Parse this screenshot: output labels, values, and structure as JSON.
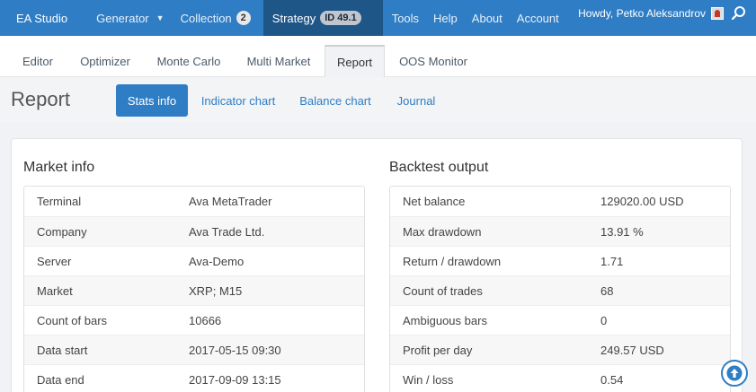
{
  "topnav": {
    "brand": "EA Studio",
    "generator": "Generator",
    "collection": "Collection",
    "collection_count": "2",
    "strategy": "Strategy",
    "strategy_id": "ID 49.1",
    "tools": "Tools",
    "help": "Help",
    "about": "About",
    "account": "Account",
    "howdy": "Howdy, Petko Aleksandrov"
  },
  "subtabs": [
    "Editor",
    "Optimizer",
    "Monte Carlo",
    "Multi Market",
    "Report",
    "OOS Monitor"
  ],
  "page": {
    "title": "Report",
    "buttons": [
      "Stats info",
      "Indicator chart",
      "Balance chart",
      "Journal"
    ]
  },
  "market_info": {
    "title": "Market info",
    "rows": [
      {
        "label": "Terminal",
        "value": "Ava MetaTrader"
      },
      {
        "label": "Company",
        "value": "Ava Trade Ltd."
      },
      {
        "label": "Server",
        "value": "Ava-Demo"
      },
      {
        "label": "Market",
        "value": "XRP; M15"
      },
      {
        "label": "Count of bars",
        "value": "10666"
      },
      {
        "label": "Data start",
        "value": "2017-05-15 09:30"
      },
      {
        "label": "Data end",
        "value": "2017-09-09 13:15"
      }
    ]
  },
  "backtest_output": {
    "title": "Backtest output",
    "rows": [
      {
        "label": "Net balance",
        "value": "129020.00 USD"
      },
      {
        "label": "Max drawdown",
        "value": "13.91 %"
      },
      {
        "label": "Return / drawdown",
        "value": "1.71"
      },
      {
        "label": "Count of trades",
        "value": "68"
      },
      {
        "label": "Ambiguous bars",
        "value": "0"
      },
      {
        "label": "Profit per day",
        "value": "249.57 USD"
      },
      {
        "label": "Win / loss",
        "value": "0.54"
      }
    ]
  }
}
